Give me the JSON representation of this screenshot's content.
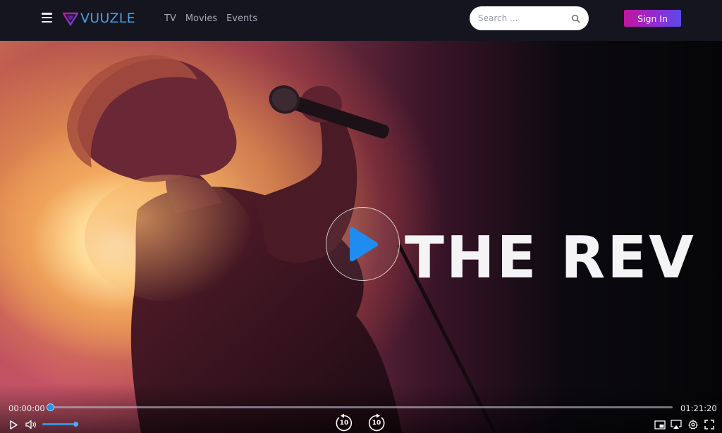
{
  "header": {
    "logo_text": "VUUZLE",
    "nav": [
      "TV",
      "Movies",
      "Events"
    ],
    "search_placeholder": "Search ...",
    "signin_label": "Sign In"
  },
  "hero": {
    "title": "THE REV"
  },
  "player": {
    "current_time": "00:00:00",
    "total_time": "01:21:20",
    "progress": 0.0,
    "volume": 0.9,
    "skip_back_seconds": "10",
    "skip_forward_seconds": "10"
  },
  "icons": {
    "menu": "hamburger-menu-icon",
    "logo": "vuuzle-triangle-logo-icon",
    "search": "search-icon",
    "play_big": "play-icon",
    "play": "play-icon",
    "volume": "volume-icon",
    "rewind": "rewind-10-icon",
    "forward": "forward-10-icon",
    "pip": "picture-in-picture-icon",
    "airplay": "airplay-icon",
    "settings": "gear-icon",
    "fullscreen": "fullscreen-icon"
  },
  "colors": {
    "accent_blue": "#2f8fe0",
    "signin_gradient_start": "#c0169e",
    "signin_gradient_end": "#5a4ae8",
    "header_bg": "#14151f"
  }
}
